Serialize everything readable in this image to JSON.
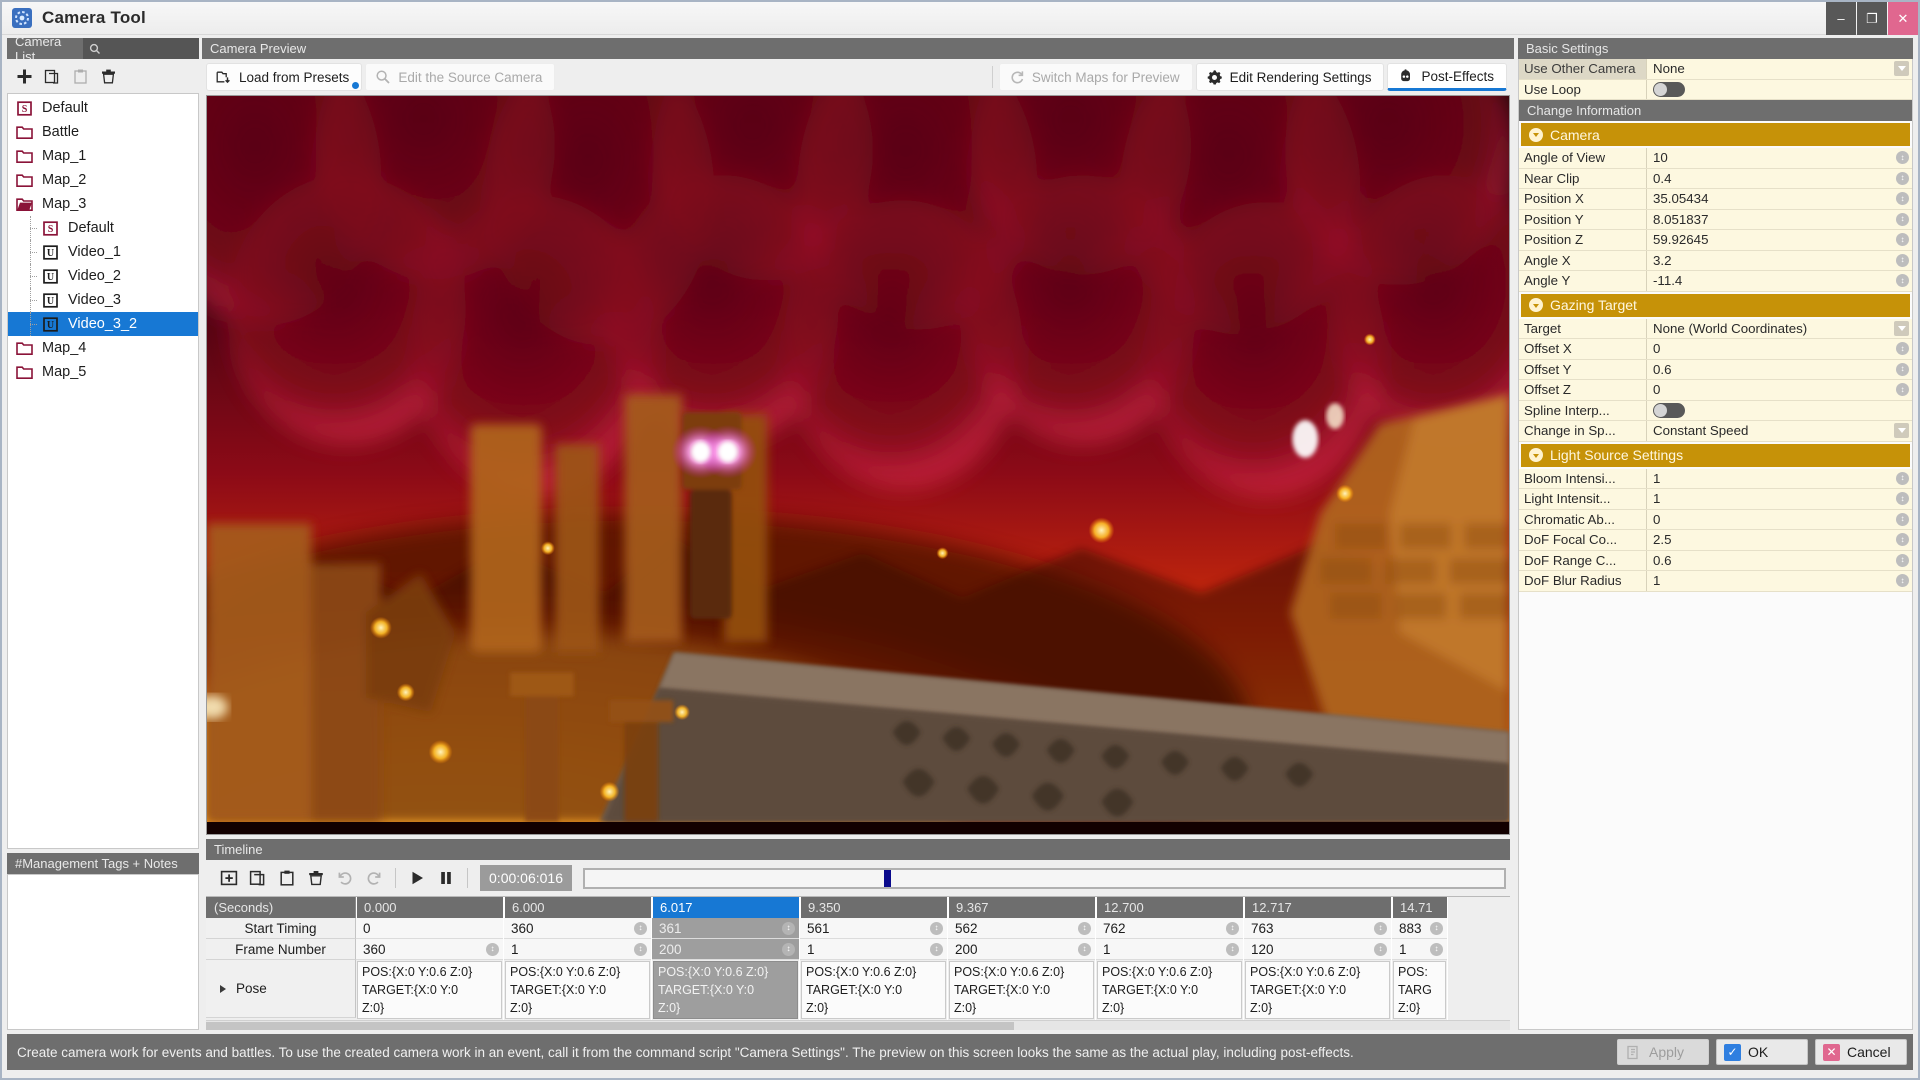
{
  "window": {
    "title": "Camera Tool",
    "app_icon": "camera-gear-icon",
    "minimize": "–",
    "maximize": "❐",
    "close": "✕"
  },
  "camera_list": {
    "header": "Camera List",
    "search_icon": "search-icon",
    "toolbar": [
      {
        "name": "add-camera-button",
        "icon": "plus-icon",
        "disabled": false
      },
      {
        "name": "copy-camera-button",
        "icon": "copy-icon",
        "disabled": false
      },
      {
        "name": "paste-camera-button",
        "icon": "paste-icon",
        "disabled": true
      },
      {
        "name": "delete-camera-button",
        "icon": "trash-icon",
        "disabled": false
      }
    ],
    "items": [
      {
        "label": "Default",
        "icon": "script-icon",
        "depth": 0,
        "selected": false
      },
      {
        "label": "Battle",
        "icon": "folder-icon",
        "depth": 0,
        "selected": false
      },
      {
        "label": "Map_1",
        "icon": "folder-icon",
        "depth": 0,
        "selected": false
      },
      {
        "label": "Map_2",
        "icon": "folder-icon",
        "depth": 0,
        "selected": false
      },
      {
        "label": "Map_3",
        "icon": "folder-open-icon",
        "depth": 0,
        "selected": false
      },
      {
        "label": "Default",
        "icon": "script-icon",
        "depth": 1,
        "selected": false
      },
      {
        "label": "Video_1",
        "icon": "video-icon",
        "depth": 1,
        "selected": false
      },
      {
        "label": "Video_2",
        "icon": "video-icon",
        "depth": 1,
        "selected": false
      },
      {
        "label": "Video_3",
        "icon": "video-icon",
        "depth": 1,
        "selected": false
      },
      {
        "label": "Video_3_2",
        "icon": "video-icon",
        "depth": 1,
        "selected": true
      },
      {
        "label": "Map_4",
        "icon": "folder-icon",
        "depth": 0,
        "selected": false
      },
      {
        "label": "Map_5",
        "icon": "folder-icon",
        "depth": 0,
        "selected": false
      }
    ],
    "notes_header": "#Management Tags + Notes",
    "notes_value": ""
  },
  "preview": {
    "header": "Camera Preview",
    "buttons": {
      "load_presets": "Load from Presets",
      "edit_source_camera": "Edit the Source Camera",
      "switch_maps": "Switch Maps for Preview",
      "edit_rendering": "Edit Rendering Settings",
      "post_effects": "Post-Effects"
    }
  },
  "timeline": {
    "header": "Timeline",
    "toolbar": [
      {
        "name": "add-keyframe-button",
        "icon": "add-box-icon",
        "disabled": false
      },
      {
        "name": "copy-keyframe-button",
        "icon": "copy-icon",
        "disabled": false
      },
      {
        "name": "paste-keyframe-button",
        "icon": "paste-icon",
        "disabled": false
      },
      {
        "name": "delete-keyframe-button",
        "icon": "trash-icon",
        "disabled": false
      },
      {
        "name": "redo-button",
        "icon": "redo-icon",
        "disabled": true
      },
      {
        "name": "undo-button",
        "icon": "undo-icon",
        "disabled": true
      }
    ],
    "play_label": "▶",
    "pause_label": "❙❙",
    "time_readout": "0:00:06:016",
    "playhead_percent": 32.5,
    "row_labels": {
      "seconds": "(Seconds)",
      "start_timing": "Start Timing",
      "frame_number": "Frame Number",
      "pose": "Pose"
    },
    "columns": [
      {
        "time": "0.000",
        "start_timing": "0",
        "frame_number": "360",
        "pose": "POS:{X:0 Y:0.6 Z:0}\nTARGET:{X:0 Y:0\nZ:0}",
        "selected": false,
        "start_spin": false,
        "frame_spin": true
      },
      {
        "time": "6.000",
        "start_timing": "360",
        "frame_number": "1",
        "pose": "POS:{X:0 Y:0.6 Z:0}\nTARGET:{X:0 Y:0\nZ:0}",
        "selected": false,
        "start_spin": true,
        "frame_spin": true
      },
      {
        "time": "6.017",
        "start_timing": "361",
        "frame_number": "200",
        "pose": "POS:{X:0 Y:0.6 Z:0}\nTARGET:{X:0 Y:0\nZ:0}",
        "selected": true,
        "start_spin": true,
        "frame_spin": true
      },
      {
        "time": "9.350",
        "start_timing": "561",
        "frame_number": "1",
        "pose": "POS:{X:0 Y:0.6 Z:0}\nTARGET:{X:0 Y:0\nZ:0}",
        "selected": false,
        "start_spin": true,
        "frame_spin": true
      },
      {
        "time": "9.367",
        "start_timing": "562",
        "frame_number": "200",
        "pose": "POS:{X:0 Y:0.6 Z:0}\nTARGET:{X:0 Y:0\nZ:0}",
        "selected": false,
        "start_spin": true,
        "frame_spin": true
      },
      {
        "time": "12.700",
        "start_timing": "762",
        "frame_number": "1",
        "pose": "POS:{X:0 Y:0.6 Z:0}\nTARGET:{X:0 Y:0\nZ:0}",
        "selected": false,
        "start_spin": true,
        "frame_spin": true
      },
      {
        "time": "12.717",
        "start_timing": "763",
        "frame_number": "120",
        "pose": "POS:{X:0 Y:0.6 Z:0}\nTARGET:{X:0 Y:0\nZ:0}",
        "selected": false,
        "start_spin": true,
        "frame_spin": true
      },
      {
        "time": "14.71",
        "start_timing": "883",
        "frame_number": "1",
        "pose": "POS:\nTARG\nZ:0}",
        "selected": false,
        "start_spin": true,
        "frame_spin": true
      }
    ]
  },
  "settings": {
    "basic_header": "Basic Settings",
    "use_other_camera_label": "Use Other Camera",
    "use_other_camera_value": "None",
    "use_loop_label": "Use Loop",
    "change_info_header": "Change Information",
    "groups": [
      {
        "title": "Camera",
        "rows": [
          {
            "label": "Angle of View",
            "value": "10",
            "control": "spinner"
          },
          {
            "label": "Near Clip",
            "value": "0.4",
            "control": "spinner"
          },
          {
            "label": "Position X",
            "value": "35.05434",
            "control": "spinner"
          },
          {
            "label": "Position Y",
            "value": "8.051837",
            "control": "spinner"
          },
          {
            "label": "Position Z",
            "value": "59.92645",
            "control": "spinner"
          },
          {
            "label": "Angle X",
            "value": "3.2",
            "control": "spinner"
          },
          {
            "label": "Angle Y",
            "value": "-11.4",
            "control": "spinner"
          }
        ]
      },
      {
        "title": "Gazing Target",
        "rows": [
          {
            "label": "Target",
            "value": "None (World Coordinates)",
            "control": "dropdown"
          },
          {
            "label": "Offset X",
            "value": "0",
            "control": "spinner"
          },
          {
            "label": "Offset Y",
            "value": "0.6",
            "control": "spinner"
          },
          {
            "label": "Offset Z",
            "value": "0",
            "control": "spinner"
          },
          {
            "label": "Spline Interp...",
            "value": "",
            "control": "toggle"
          },
          {
            "label": "Change in Sp...",
            "value": "Constant Speed",
            "control": "dropdown"
          }
        ]
      },
      {
        "title": "Light Source Settings",
        "rows": [
          {
            "label": "Bloom Intensi...",
            "value": "1",
            "control": "spinner"
          },
          {
            "label": "Light Intensit...",
            "value": "1",
            "control": "spinner"
          },
          {
            "label": "Chromatic Ab...",
            "value": "0",
            "control": "spinner"
          },
          {
            "label": "DoF Focal Co...",
            "value": "2.5",
            "control": "spinner"
          },
          {
            "label": "DoF Range C...",
            "value": "0.6",
            "control": "spinner"
          },
          {
            "label": "DoF Blur Radius",
            "value": "1",
            "control": "spinner"
          }
        ]
      }
    ]
  },
  "statusbar": {
    "message": "Create camera work for events and battles. To use the created camera work in an event, call it from the command script \"Camera Settings\". The preview on this screen looks the same as the actual play, including post-effects.",
    "apply": "Apply",
    "ok": "OK",
    "cancel": "Cancel"
  },
  "colors": {
    "accent_blue": "#1778d4",
    "category_gold": "#c69208",
    "panel_cream": "#fdf8e0",
    "header_gray": "#6e6e6e",
    "close_pink": "#e0678f"
  }
}
